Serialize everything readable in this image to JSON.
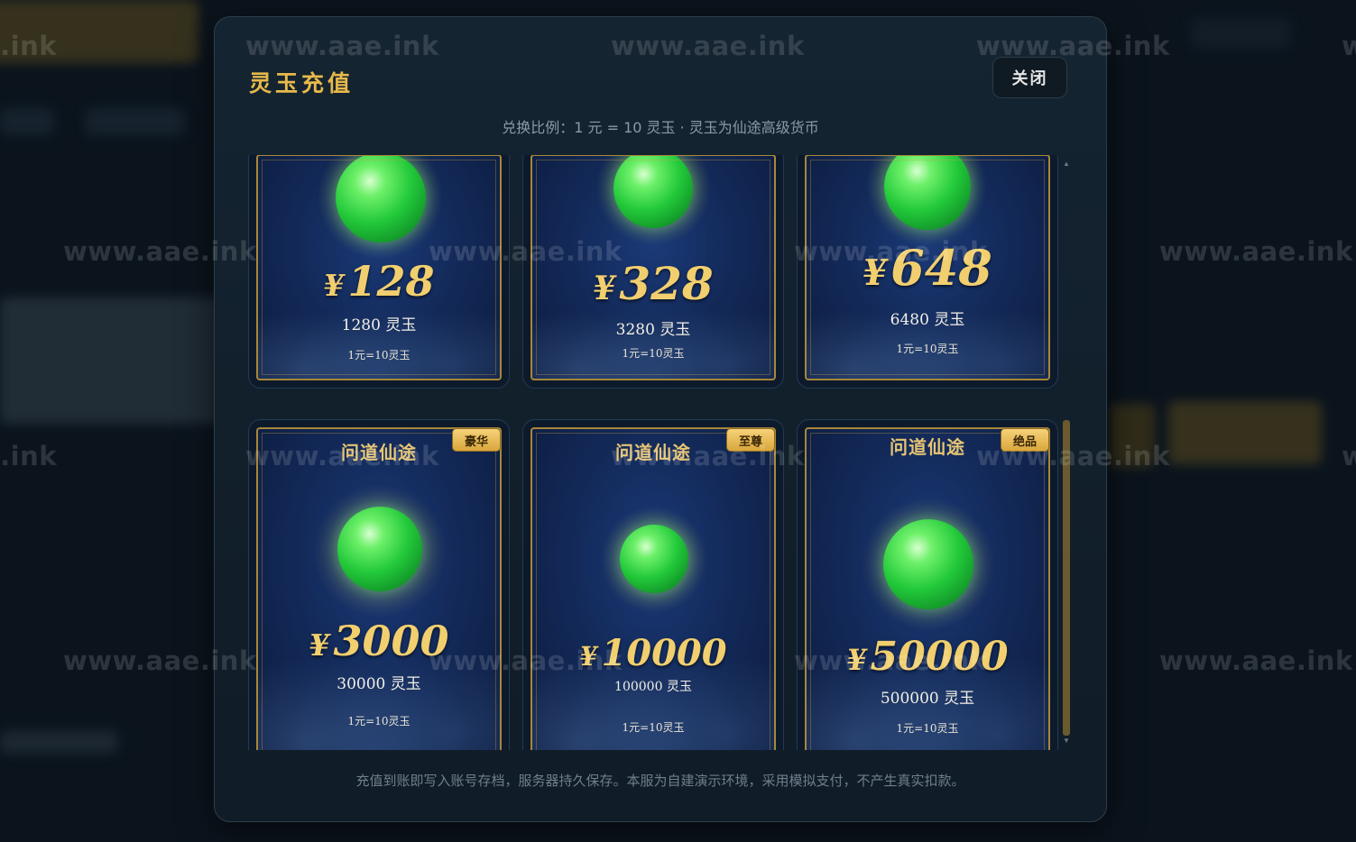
{
  "modal": {
    "title": "灵玉充值",
    "close_label": "关闭",
    "subtitle": "兑换比例：1 元 = 10 灵玉 · 灵玉为仙途高级货币",
    "footer_note": "充值到账即写入账号存档，服务器持久保存。本服为自建演示环境，采用模拟支付，不产生真实扣款。"
  },
  "packages": [
    {
      "price": "128",
      "amount": "1280 灵玉",
      "rate": "1元=10灵玉"
    },
    {
      "price": "328",
      "amount": "3280 灵玉",
      "rate": "1元=10灵玉"
    },
    {
      "price": "648",
      "amount": "6480 灵玉",
      "rate": "1元=10灵玉"
    },
    {
      "price": "3000",
      "amount": "30000 灵玉",
      "rate": "1元=10灵玉",
      "brand": "问道仙途",
      "badge": "豪华"
    },
    {
      "price": "10000",
      "amount": "100000 灵玉",
      "rate": "1元=10灵玉",
      "brand": "问道仙途",
      "badge": "至尊"
    },
    {
      "price": "50000",
      "amount": "500000 灵玉",
      "rate": "1元=10灵玉",
      "brand": "问道仙途",
      "badge": "绝品"
    }
  ],
  "currency_symbol": "¥",
  "watermark_text": "www.aae.ink",
  "colors": {
    "accent_gold": "#e8b94a",
    "card_frame": "#a88738",
    "jade": "#22c93a"
  },
  "icons": {
    "scroll_up": "scroll-up-arrow-icon",
    "scroll_down": "scroll-down-arrow-icon"
  }
}
